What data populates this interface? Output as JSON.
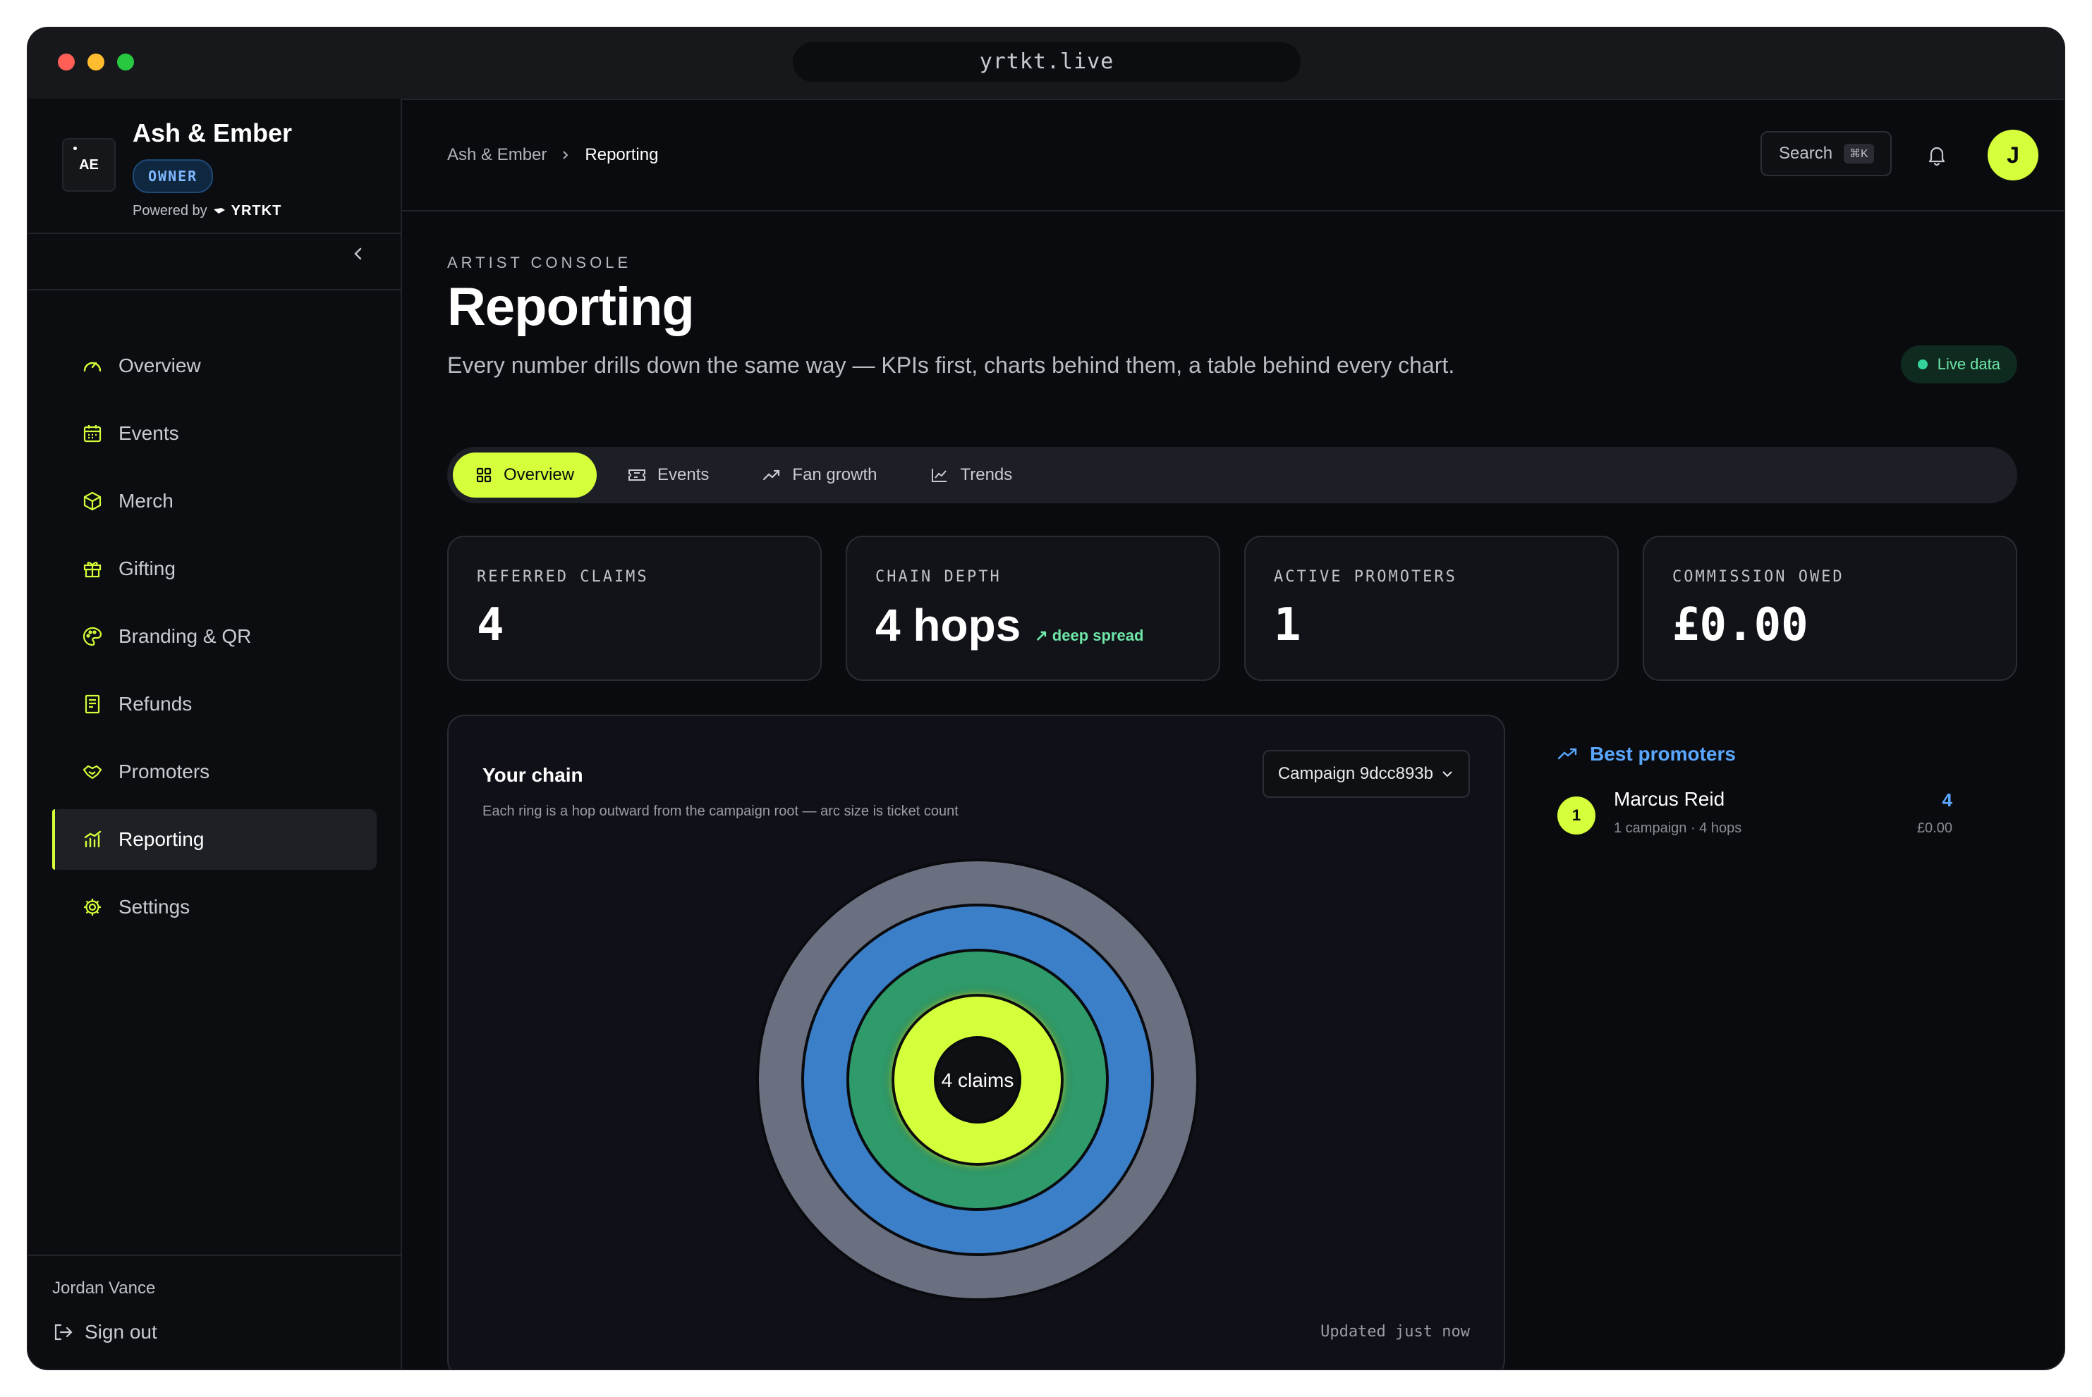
{
  "window": {
    "url": "yrtkt.live"
  },
  "brand": {
    "logo_text": "AE",
    "name": "Ash & Ember",
    "role_badge": "OWNER",
    "powered_by": "Powered by",
    "platform": "YRTKT"
  },
  "sidebar": {
    "items": [
      {
        "label": "Overview",
        "icon": "gauge-icon"
      },
      {
        "label": "Events",
        "icon": "calendar-icon"
      },
      {
        "label": "Merch",
        "icon": "box-icon"
      },
      {
        "label": "Gifting",
        "icon": "gift-icon"
      },
      {
        "label": "Branding & QR",
        "icon": "palette-icon"
      },
      {
        "label": "Refunds",
        "icon": "receipt-icon"
      },
      {
        "label": "Promoters",
        "icon": "handshake-icon"
      },
      {
        "label": "Reporting",
        "icon": "bar-chart-icon",
        "active": true
      },
      {
        "label": "Settings",
        "icon": "gear-icon"
      }
    ],
    "user_name": "Jordan Vance",
    "sign_out": "Sign out"
  },
  "topbar": {
    "breadcrumb": [
      "Ash & Ember",
      "Reporting"
    ],
    "search_label": "Search",
    "search_shortcut": "⌘K",
    "avatar_initial": "J"
  },
  "page": {
    "eyebrow": "ARTIST CONSOLE",
    "title": "Reporting",
    "subtitle": "Every number drills down the same way — KPIs first, charts behind them, a table behind every chart.",
    "live_label": "Live data"
  },
  "tabs": [
    {
      "label": "Overview",
      "active": true
    },
    {
      "label": "Events"
    },
    {
      "label": "Fan growth"
    },
    {
      "label": "Trends"
    }
  ],
  "kpis": [
    {
      "label": "REFERRED CLAIMS",
      "value": "4"
    },
    {
      "label": "CHAIN DEPTH",
      "value": "4 hops",
      "tag": "↗ deep spread"
    },
    {
      "label": "ACTIVE PROMOTERS",
      "value": "1"
    },
    {
      "label": "COMMISSION OWED",
      "value": "£0.00"
    }
  ],
  "chain": {
    "title": "Your chain",
    "subtitle": "Each ring is a hop outward from the campaign root — arc size is ticket count",
    "campaign": "Campaign 9dcc893b",
    "center_label": "4 claims",
    "updated": "Updated just now"
  },
  "chart_data": {
    "type": "sunburst",
    "center_label": "4 claims",
    "rings": [
      {
        "hop": 1,
        "tickets": 1,
        "color": "#d4ff3a"
      },
      {
        "hop": 2,
        "tickets": 1,
        "color": "#2f9a6a"
      },
      {
        "hop": 3,
        "tickets": 1,
        "color": "#3b7fc8"
      },
      {
        "hop": 4,
        "tickets": 1,
        "color": "#6b7080"
      }
    ]
  },
  "promoters": {
    "title": "Best promoters",
    "rows": [
      {
        "rank": "1",
        "name": "Marcus Reid",
        "meta": "1 campaign · 4 hops",
        "count": "4",
        "amount": "£0.00"
      }
    ]
  },
  "colors": {
    "accent": "#d4ff3a",
    "link": "#5aa7ff",
    "success": "#34d399"
  }
}
